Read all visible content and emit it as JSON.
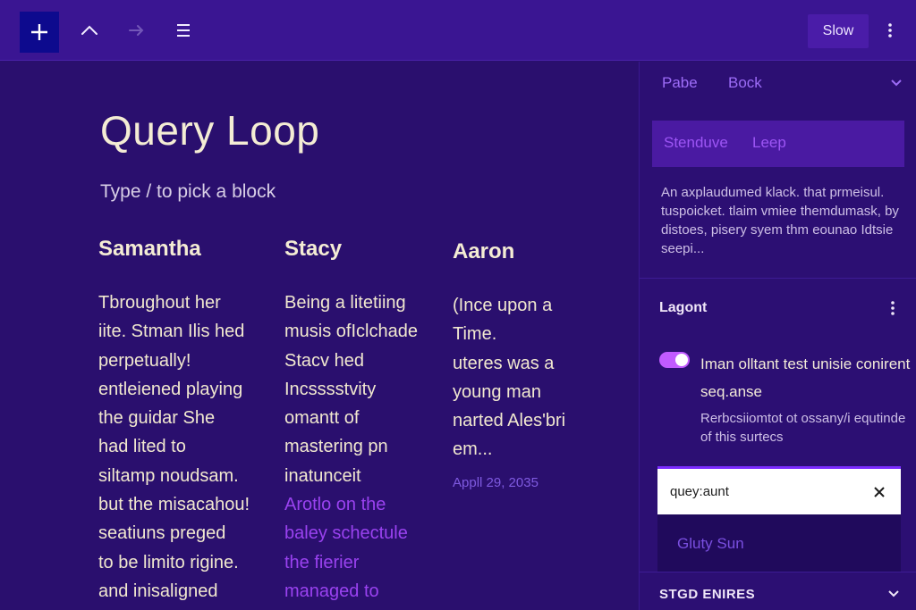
{
  "toolbar": {
    "add_icon": "plus-icon",
    "undo_icon": "chevron-up-icon",
    "redo_icon": "arrow-right-icon",
    "list_view_icon": "list-icon",
    "view_label": "Slow",
    "options_icon": "vertical-ellipsis-icon"
  },
  "canvas": {
    "title": "Query Loop",
    "appender_text": "Type / to pick a block",
    "posts": [
      {
        "author": "Samantha",
        "lines": [
          "Tbroughout her",
          "iite. Stman Ilis hed",
          "perpetually!",
          "entleiened playing",
          "the guidar She",
          "had lited to",
          "siltamp noudsam.",
          "but the misacahou!",
          "seatiuns preged",
          "to be limito rigine.",
          "and inisaligned"
        ],
        "faded_lines": [],
        "date": ""
      },
      {
        "author": "Stacy",
        "lines": [
          "Being a litetiing",
          "musis ofIclchade",
          "Stacv hed",
          "Incsssstvity",
          "omantt of",
          "mastering pn",
          "inatunceit"
        ],
        "faded_lines": [
          "Arotlo on the",
          "baley schectule",
          "the fierier",
          "managed to"
        ],
        "date": ""
      },
      {
        "author": "Aaron",
        "lines": [
          "(Ince upon a",
          "Time.",
          "uteres was a",
          "young man",
          "narted Ales'bri",
          "em..."
        ],
        "faded_lines": [],
        "date": "Appll 29, 2035"
      }
    ]
  },
  "sidebar": {
    "tabs": [
      "Pabe",
      "Bock"
    ],
    "collapse_icon": "chevron-down-icon",
    "block_card": {
      "name": "Stenduve",
      "variant": "Leep"
    },
    "block_description": "An axplaudumed klack. that prmeisul. tuspoicket. tlaim vmiee themdumask, by distoes, pisery syem thm eounao Idtsie seepi...",
    "layout_panel": {
      "title": "Lagont",
      "menu_icon": "vertical-ellipsis-icon",
      "toggle_on": true,
      "toggle_label": "Iman olltant test unisie conirent seq.anse",
      "toggle_help": "Rerbcsiiomtot ot ossany/i equtinde of this surtecs"
    },
    "search": {
      "value": "quey:aunt",
      "clear_icon": "close-icon",
      "suggestion": "Gluty Sun"
    },
    "section": {
      "title": "STGD ENIRES",
      "chevron_icon": "chevron-down-icon"
    },
    "colors": {
      "background": "#2a0f6e",
      "toolbar": "#3a1592",
      "accent": "#c15bff",
      "add_button": "#0d0a8e"
    }
  }
}
